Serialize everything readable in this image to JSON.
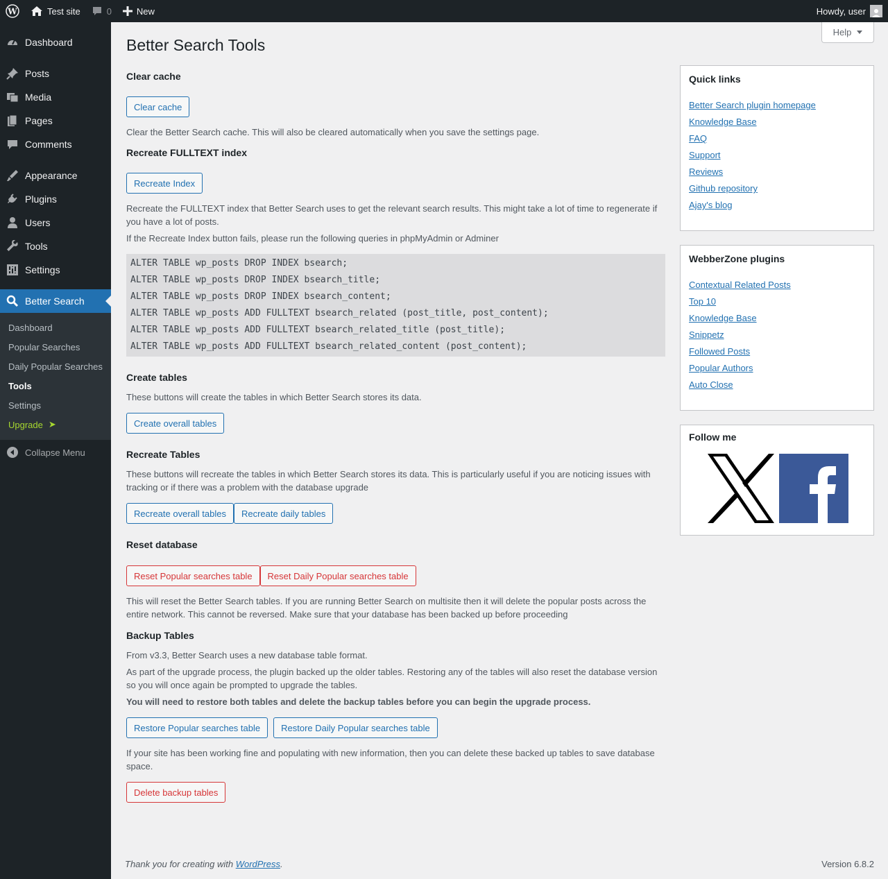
{
  "adminbar": {
    "site_name": "Test site",
    "comments_count": "0",
    "new_label": "New",
    "greeting": "Howdy, user"
  },
  "sidebar": {
    "items": [
      {
        "label": "Dashboard",
        "icon": "dashboard-icon"
      },
      {
        "label": "Posts",
        "icon": "pin-icon"
      },
      {
        "label": "Media",
        "icon": "media-icon"
      },
      {
        "label": "Pages",
        "icon": "pages-icon"
      },
      {
        "label": "Comments",
        "icon": "comment-icon"
      },
      {
        "label": "Appearance",
        "icon": "brush-icon"
      },
      {
        "label": "Plugins",
        "icon": "plug-icon"
      },
      {
        "label": "Users",
        "icon": "user-icon"
      },
      {
        "label": "Tools",
        "icon": "wrench-icon"
      },
      {
        "label": "Settings",
        "icon": "settings-icon"
      },
      {
        "label": "Better Search",
        "icon": "search-icon"
      }
    ],
    "submenu": [
      "Dashboard",
      "Popular Searches",
      "Daily Popular Searches",
      "Tools",
      "Settings",
      "Upgrade"
    ],
    "upgrade_arrow": "➤",
    "collapse_label": "Collapse Menu"
  },
  "help_label": "Help",
  "page_title": "Better Search Tools",
  "sections": {
    "clear_cache": {
      "heading": "Clear cache",
      "button": "Clear cache",
      "desc": "Clear the Better Search cache. This will also be cleared automatically when you save the settings page."
    },
    "recreate_index": {
      "heading": "Recreate FULLTEXT index",
      "button": "Recreate Index",
      "desc1": "Recreate the FULLTEXT index that Better Search uses to get the relevant search results. This might take a lot of time to regenerate if you have a lot of posts.",
      "desc2": "If the Recreate Index button fails, please run the following queries in phpMyAdmin or Adminer",
      "sql": [
        "ALTER TABLE wp_posts DROP INDEX bsearch;",
        "ALTER TABLE wp_posts DROP INDEX bsearch_title;",
        "ALTER TABLE wp_posts DROP INDEX bsearch_content;",
        "ALTER TABLE wp_posts ADD FULLTEXT bsearch_related (post_title, post_content);",
        "ALTER TABLE wp_posts ADD FULLTEXT bsearch_related_title (post_title);",
        "ALTER TABLE wp_posts ADD FULLTEXT bsearch_related_content (post_content);"
      ]
    },
    "create_tables": {
      "heading": "Create tables",
      "desc": "These buttons will create the tables in which Better Search stores its data.",
      "button": "Create overall tables"
    },
    "recreate_tables": {
      "heading": "Recreate Tables",
      "desc": "These buttons will recreate the tables in which Better Search stores its data. This is particularly useful if you are noticing issues with tracking or if there was a problem with the database upgrade",
      "button1": "Recreate overall tables",
      "button2": "Recreate daily tables"
    },
    "reset_db": {
      "heading": "Reset database",
      "button1": "Reset Popular searches table",
      "button2": "Reset Daily Popular searches table",
      "desc": "This will reset the Better Search tables. If you are running Better Search on multisite then it will delete the popular posts across the entire network. This cannot be reversed. Make sure that your database has been backed up before proceeding"
    },
    "backup": {
      "heading": "Backup Tables",
      "desc1": "From v3.3, Better Search uses a new database table format.",
      "desc2": "As part of the upgrade process, the plugin backed up the older tables. Restoring any of the tables will also reset the database version so you will once again be prompted to upgrade the tables.",
      "desc3": "You will need to restore both tables and delete the backup tables before you can begin the upgrade process.",
      "button1": "Restore Popular searches table",
      "button2": "Restore Daily Popular searches table",
      "desc4": "If your site has been working fine and populating with new information, then you can delete these backed up tables to save database space.",
      "button3": "Delete backup tables"
    }
  },
  "quick_links": {
    "title": "Quick links",
    "links": [
      "Better Search plugin homepage",
      "Knowledge Base",
      "FAQ",
      "Support",
      "Reviews",
      "Github repository",
      "Ajay's blog"
    ]
  },
  "webberzone": {
    "title": "WebberZone plugins",
    "links": [
      "Contextual Related Posts",
      "Top 10",
      "Knowledge Base",
      "Snippetz",
      "Followed Posts",
      "Popular Authors",
      "Auto Close"
    ]
  },
  "follow": {
    "title": "Follow me"
  },
  "footer": {
    "thanks_prefix": "Thank you for creating with ",
    "thanks_link": "WordPress",
    "thanks_suffix": ".",
    "version": "Version 6.8.2"
  },
  "colors": {
    "accent": "#2271b1",
    "danger": "#d63638",
    "sidebar_bg": "#1d2327",
    "upgrade": "#a6d72f"
  }
}
